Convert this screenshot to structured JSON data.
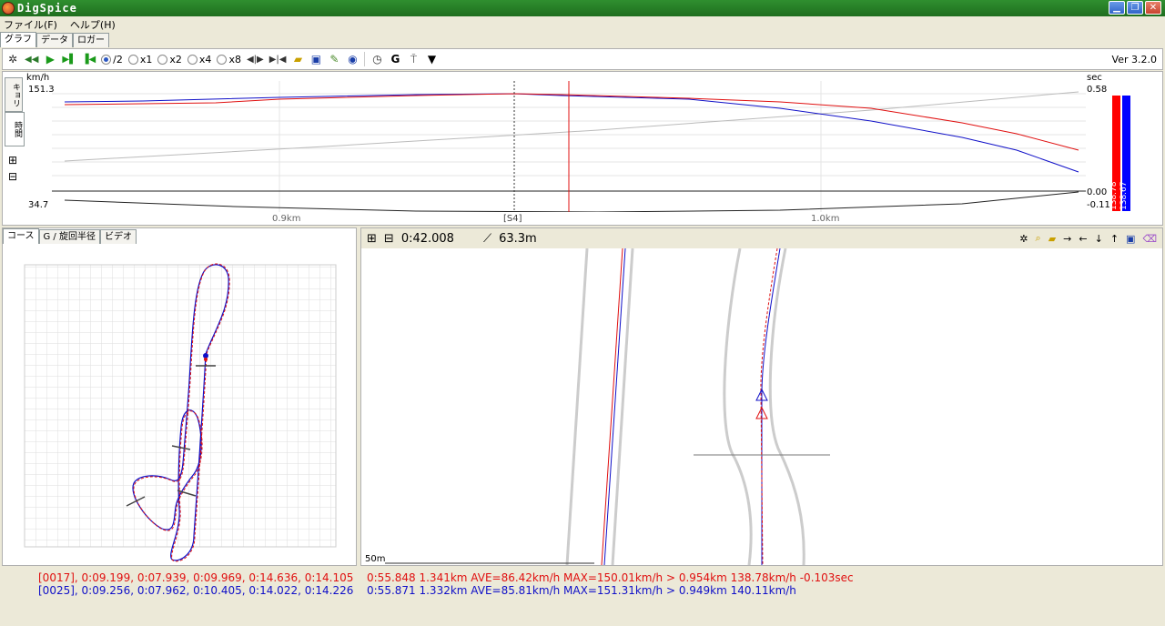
{
  "window": {
    "title": "DigSpice",
    "min": "▁",
    "max": "❐",
    "close": "✕"
  },
  "menu": [
    "ファイル(F)",
    "ヘルプ(H)"
  ],
  "main_tabs": [
    "グラフ",
    "データ",
    "ロガー"
  ],
  "toolbar": {
    "radios": [
      "/2",
      "x1",
      "x2",
      "x4",
      "x8"
    ],
    "selected_radio": "/2",
    "g_label": "G",
    "version": "Ver 3.2.0"
  },
  "graph": {
    "vtabs": [
      "キョリ",
      "時間"
    ],
    "left_unit": "km/h",
    "left_max": "151.3",
    "left_min": "34.7",
    "right_unit": "sec",
    "right_max": "0.58",
    "right_mid": "0.00",
    "right_min": "-0.11",
    "x_labels": [
      "0.9km",
      "[S4]",
      "1.0km"
    ],
    "bar_red_label": "138.78",
    "bar_blue_label": "138.67",
    "colors": {
      "red": "#e01010",
      "blue": "#1010c8"
    }
  },
  "course_panel": {
    "tabs": [
      "コース",
      "G / 旋回半径",
      "ビデオ"
    ]
  },
  "zoom_panel": {
    "time": "0:42.008",
    "distance": "63.3m",
    "scale_label": "50m"
  },
  "status": {
    "left_red": "[0017], 0:09.199, 0:07.939, 0:09.969, 0:14.636, 0:14.105",
    "left_blue": "[0025], 0:09.256, 0:07.962, 0:10.405, 0:14.022, 0:14.226",
    "right_red": "0:55.848 1.341km AVE=86.42km/h MAX=150.01km/h > 0.954km 138.78km/h -0.103sec",
    "right_blue": "0:55.871 1.332km AVE=85.81km/h MAX=151.31km/h > 0.949km 140.11km/h"
  }
}
